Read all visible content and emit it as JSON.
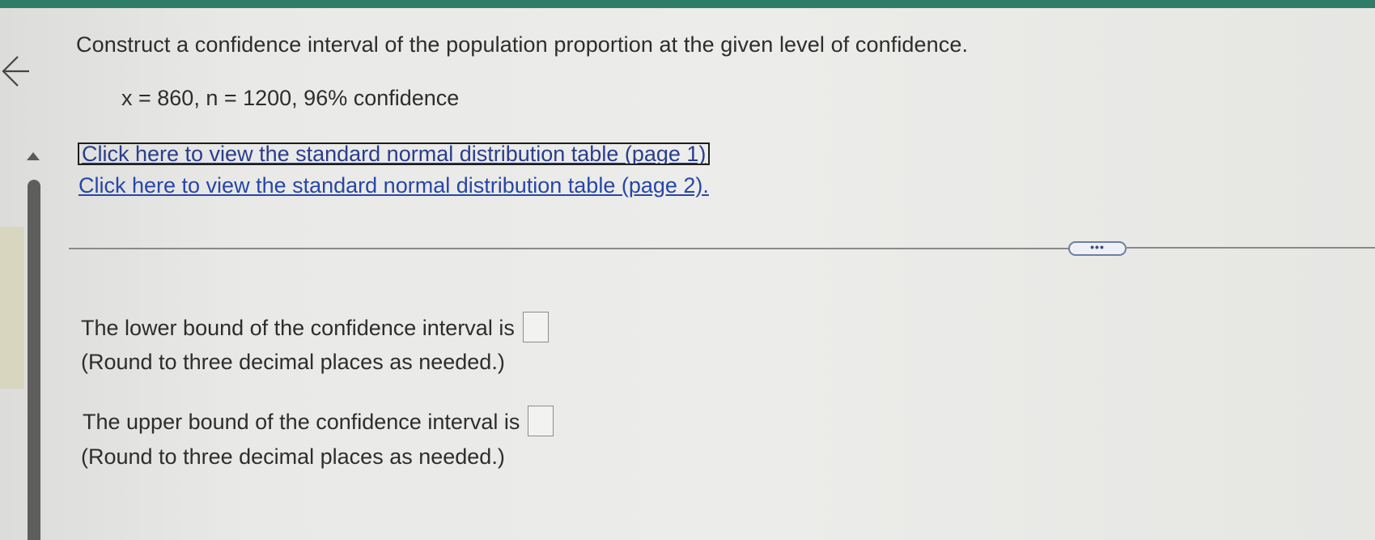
{
  "header": {
    "accent_color": "#2e7d68"
  },
  "question": {
    "prompt": "Construct a confidence interval of the population proportion at the given level of confidence.",
    "given": "x = 860, n = 1200, 96% confidence"
  },
  "links": [
    {
      "label": "Click here to view the standard normal distribution table (page 1)"
    },
    {
      "label": "Click here to view the standard normal distribution table (page 2)."
    }
  ],
  "more_button": {
    "label": "•••"
  },
  "answers": {
    "lower": {
      "label": "The lower bound of the confidence interval is",
      "value": "",
      "hint": "(Round to three decimal places as needed.)"
    },
    "upper": {
      "label": "The upper bound of the confidence interval is",
      "value": "",
      "hint": "(Round to three decimal places as needed.)"
    }
  }
}
